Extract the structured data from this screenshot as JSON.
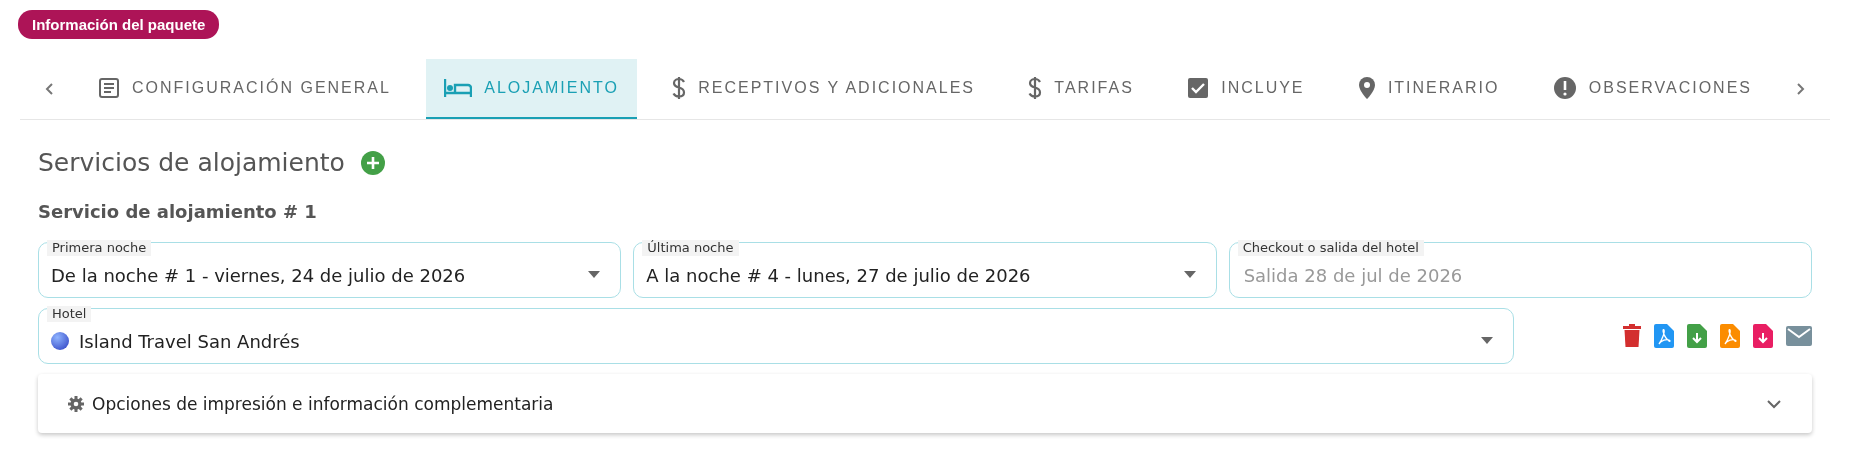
{
  "badge": "Información del paquete",
  "tabs": [
    {
      "label": "CONFIGURACIÓN GENERAL",
      "selected": false
    },
    {
      "label": "ALOJAMIENTO",
      "selected": true
    },
    {
      "label": "RECEPTIVOS Y ADICIONALES",
      "selected": false
    },
    {
      "label": "TARIFAS",
      "selected": false
    },
    {
      "label": "INCLUYE",
      "selected": false
    },
    {
      "label": "ITINERARIO",
      "selected": false
    },
    {
      "label": "OBSERVACIONES",
      "selected": false
    }
  ],
  "section_title": "Servicios de alojamiento",
  "service_title": "Servicio de alojamiento # 1",
  "fields": [
    {
      "kind": "select",
      "label": "Primera noche",
      "value": "De la noche # 1 - viernes, 24 de julio de 2026"
    },
    {
      "kind": "select",
      "label": "Última noche",
      "value": "A la noche # 4 - lunes, 27 de julio de 2026"
    },
    {
      "kind": "text",
      "label": "Checkout o salida del hotel",
      "placeholder": "Salida 28 de jul de 2026"
    }
  ],
  "hotel": {
    "label": "Hotel",
    "value": "Island Travel San Andrés"
  },
  "panel": {
    "title": "Opciones de impresión e información complementaria",
    "expanded": false
  }
}
